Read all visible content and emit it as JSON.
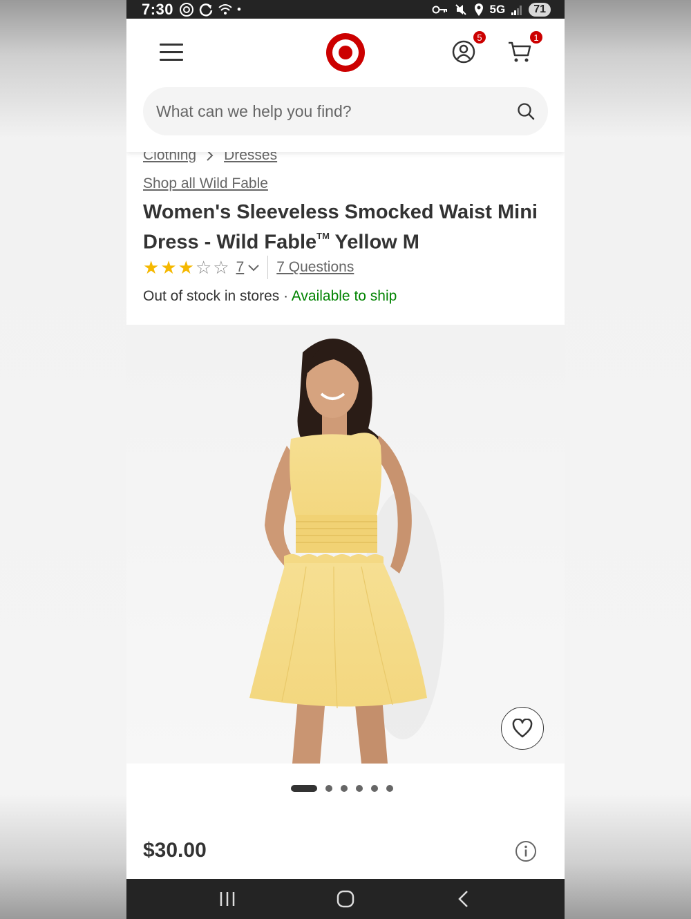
{
  "status_bar": {
    "time": "7:30",
    "network": "5G",
    "battery": "71"
  },
  "header": {
    "account_badge": "5",
    "cart_badge": "1",
    "brand_color": "#cc0000"
  },
  "search": {
    "placeholder": "What can we help you find?",
    "value": ""
  },
  "breadcrumb": {
    "items": [
      "Clothing",
      "Dresses"
    ]
  },
  "product": {
    "shop_all_link": "Shop all Wild Fable",
    "title_part1": "Women's Sleeveless Smocked Waist Mini Dress - Wild Fable",
    "title_tm": "TM",
    "title_part2": " Yellow M",
    "rating_stars": 3,
    "rating_max": 5,
    "rating_count": "7",
    "questions_link": "7 Questions",
    "stock_text": "Out of stock in stores",
    "stock_separator": " · ",
    "ship_text": "Available to ship",
    "ship_color": "#008300",
    "price": "$30.00"
  },
  "gallery": {
    "image_count": 6,
    "active_index": 0
  },
  "icons": {
    "menu": "menu-icon",
    "logo": "target-logo",
    "account": "account-icon",
    "cart": "cart-icon",
    "search": "search-icon",
    "wishlist": "heart-icon",
    "info": "info-icon"
  }
}
